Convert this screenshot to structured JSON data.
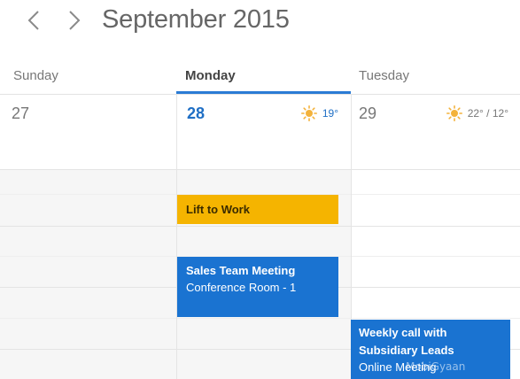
{
  "header": {
    "month_title": "September 2015",
    "prev_icon": "chevron-left-icon",
    "next_icon": "chevron-right-icon"
  },
  "days": [
    {
      "name": "Sunday",
      "date": "27"
    },
    {
      "name": "Monday",
      "date": "28",
      "selected": true,
      "weather": {
        "icon": "sun-icon",
        "text": "19°"
      }
    },
    {
      "name": "Tuesday",
      "date": "29",
      "weather": {
        "icon": "sun-icon",
        "text": "22° / 12°"
      }
    }
  ],
  "events": {
    "lift_to_work": {
      "title": "Lift to Work",
      "color": "#f5b400"
    },
    "sales_team_meeting": {
      "title": "Sales Team Meeting",
      "location": "Conference Room - 1",
      "color": "#1a73d1"
    },
    "weekly_call": {
      "title": "Weekly call with Subsidiary Leads",
      "location": "Online Meeting",
      "color": "#1a73d1"
    }
  },
  "colors": {
    "accent": "#2a7bd4",
    "today_text": "#1f6fc5",
    "sun_icon": "#f3b23b"
  },
  "watermark": "MobiGyaan"
}
